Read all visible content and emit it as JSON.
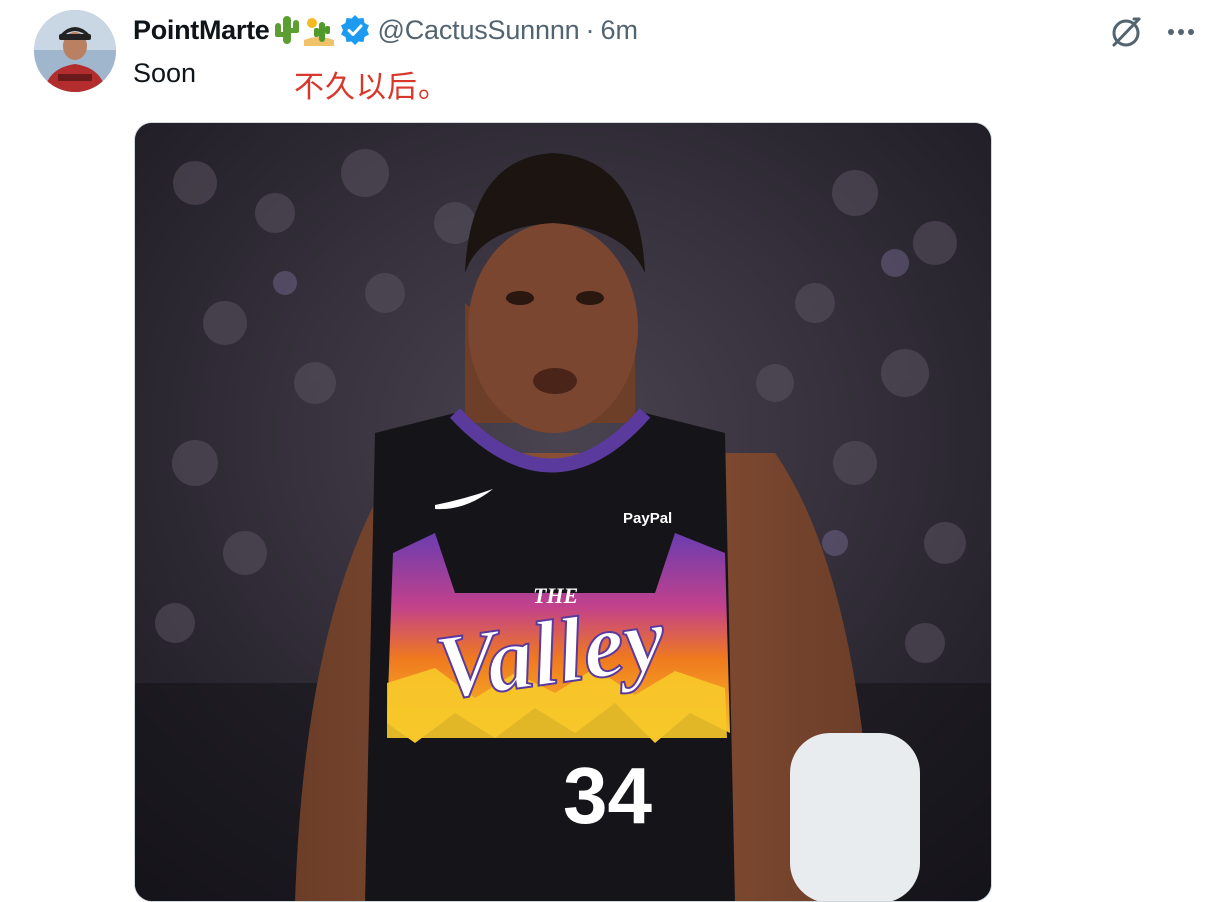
{
  "tweet": {
    "display_name": "PointMarte",
    "name_emojis": [
      "cactus-emoji",
      "desert-cactus-emoji"
    ],
    "verified": true,
    "handle": "@CactusSunnnn",
    "separator": "·",
    "time": "6m",
    "text": "Soon",
    "translation": "不久以后。",
    "media": {
      "type": "photo",
      "jersey_wordmark_small": "THE",
      "jersey_wordmark": "Valley",
      "jersey_number": "34",
      "sponsor_patch": "PayPal"
    }
  },
  "colors": {
    "text_primary": "#0f1419",
    "text_secondary": "#536471",
    "verified_blue": "#1d9bf0",
    "translation_red": "#d8372c",
    "jersey_purple": "#5b3a9e",
    "jersey_orange": "#f07a1f",
    "jersey_yellow": "#f7c92a"
  },
  "icons": {
    "grok": "grok-icon",
    "more": "more-dots-icon",
    "verified": "verified-badge-icon"
  }
}
